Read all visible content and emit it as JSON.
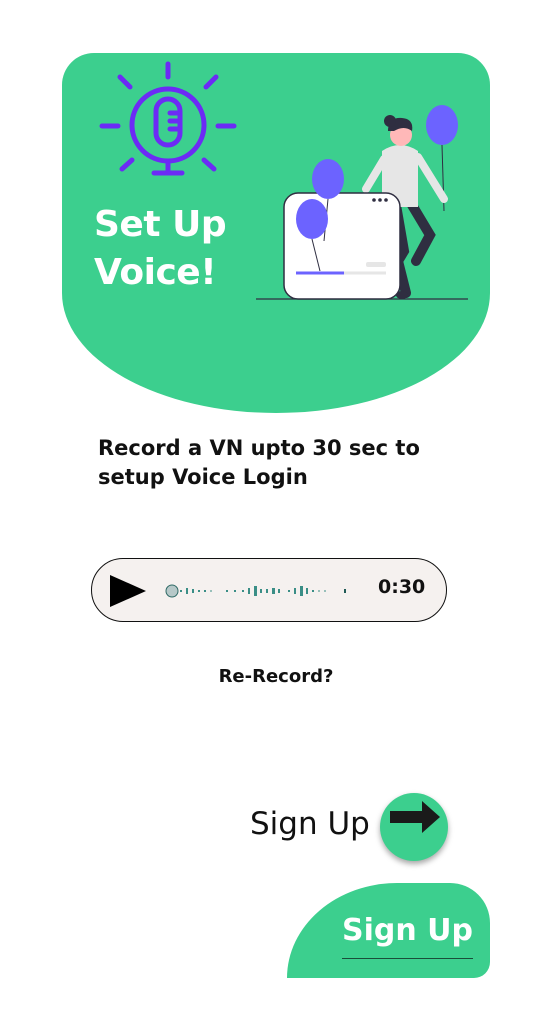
{
  "header": {
    "title_line1": "Set Up",
    "title_line2": "Voice!"
  },
  "instruction": {
    "line1": "Record a VN upto 30 sec to",
    "line2": "setup Voice Login"
  },
  "player": {
    "duration": "0:30",
    "play_icon": "play-icon"
  },
  "rerecord_label": "Re-Record?",
  "signup": {
    "label": "Sign Up",
    "arrow_icon": "arrow-right-icon"
  },
  "signup_blob": {
    "label": "Sign Up"
  },
  "colors": {
    "accent": "#3ccf8e",
    "icon_purple": "#6c2bf5",
    "balloon": "#6c63ff",
    "player_bg": "#f5f1ef",
    "text": "#111111"
  }
}
